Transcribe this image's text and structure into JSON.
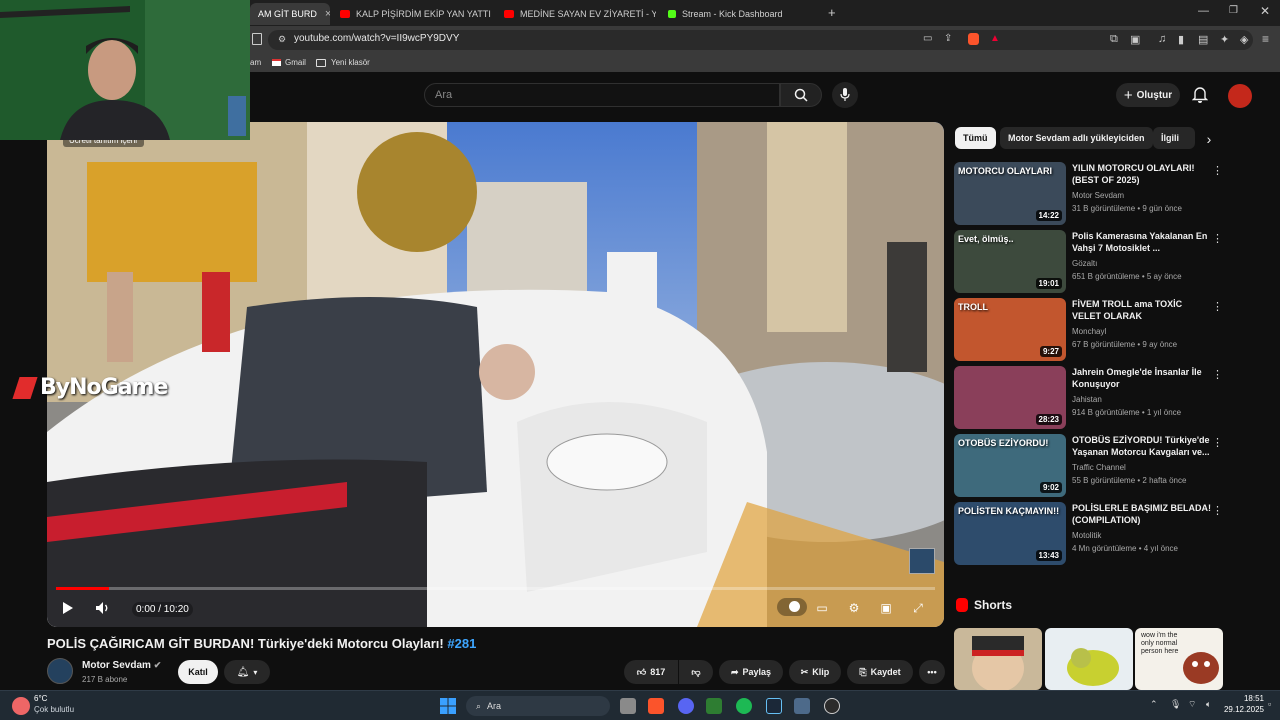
{
  "browser": {
    "tabs": [
      {
        "label": "AM GİT BURD",
        "active": true
      },
      {
        "label": "KALP PİŞİRDİM EKİP YAN YATTI - Mo",
        "active": false
      },
      {
        "label": "MEDİNE SAYAN EV ZİYARETİ - YouTub",
        "active": false
      },
      {
        "label": "Stream - Kick Dashboard",
        "active": false
      }
    ],
    "new_tab": "+",
    "url": "youtube.com/watch?v=II9wcPY9DVY",
    "bookmarks": [
      "am",
      "Gmail",
      "Yeni klasör"
    ]
  },
  "header": {
    "search_placeholder": "Ara",
    "create_label": "Oluştur"
  },
  "overlay": {
    "stream_logo": "ByNoGame",
    "paid_promo": "Ücretli tanıtım içerir"
  },
  "player": {
    "time": "0:00 / 10:20",
    "progress": 0.06
  },
  "video": {
    "title": "POLİS ÇAĞIRICAM GİT BURDAN! Türkiye'deki Motorcu Olayları!",
    "hashtag": "#281",
    "channel": "Motor Sevdam",
    "subscribers": "217 B abone",
    "join_label": "Katıl",
    "likes": "817",
    "share_label": "Paylaş",
    "clip_label": "Klip",
    "save_label": "Kaydet"
  },
  "chips": [
    "Tümü",
    "Motor Sevdam adlı yükleyiciden",
    "İlgili"
  ],
  "recommendations": [
    {
      "title": "YILIN MOTORCU OLAYLARI! (BEST OF 2025)",
      "channel": "Motor Sevdam",
      "meta": "31 B görüntüleme • 9 gün önce",
      "duration": "14:22",
      "thumb_text": "MOTORCU OLAYLARI",
      "color": "#3b4a5a"
    },
    {
      "title": "Polis Kamerasına Yakalanan En Vahşi 7 Motosiklet ...",
      "channel": "Gözaltı",
      "meta": "651 B görüntüleme • 5 ay önce",
      "duration": "19:01",
      "thumb_text": "Evet, ölmüş..",
      "color": "#3d4a3d"
    },
    {
      "title": "FİVEM TROLL ama TOXİC VELET OLARAK",
      "channel": "Monchayl",
      "meta": "67 B görüntüleme • 9 ay önce",
      "duration": "9:27",
      "thumb_text": "TROLL",
      "color": "#c2562e"
    },
    {
      "title": "Jahrein Omegle'de İnsanlar İle Konuşuyor",
      "channel": "Jahistan",
      "meta": "914 B görüntüleme • 1 yıl önce",
      "duration": "28:23",
      "thumb_text": "",
      "color": "#8a3f5a"
    },
    {
      "title": "OTOBÜS EZİYORDU! Türkiye'de Yaşanan Motorcu Kavgaları ve...",
      "channel": "Traffic Channel",
      "meta": "55 B görüntüleme • 2 hafta önce",
      "duration": "9:02",
      "thumb_text": "OTOBÜS EZİYORDU!",
      "color": "#3e6a7c"
    },
    {
      "title": "POLİSLERLE BAŞIMIZ BELADA! (COMPILATION)",
      "channel": "Motolitik",
      "meta": "4 Mn görüntüleme • 4 yıl önce",
      "duration": "13:43",
      "thumb_text": "POLİSTEN KAÇMAYIN!!",
      "color": "#2e4c6c"
    }
  ],
  "shorts": {
    "heading": "Shorts",
    "items": [
      {
        "color": "#c9b89a",
        "text": ""
      },
      {
        "color": "#b8c04a",
        "text": ""
      },
      {
        "color": "#f4f1ea",
        "text": "wow i'm the only normal person here"
      }
    ]
  },
  "taskbar": {
    "temp": "6°C",
    "weather": "Çok bulutlu",
    "search": "Ara",
    "time": "18:51",
    "date": "29.12.2025"
  }
}
